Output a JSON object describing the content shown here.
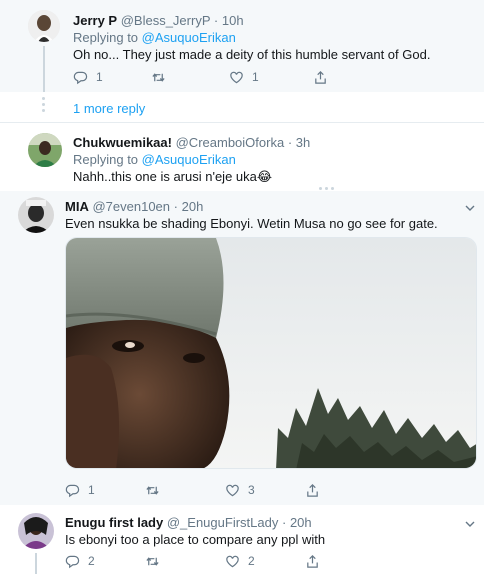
{
  "tweets": [
    {
      "name": "Jerry P",
      "handle": "@Bless_JerryP",
      "time": "10h",
      "replying_prefix": "Replying to",
      "replying_handle": "@AsuquoErikan",
      "text": "Oh no... They just made a deity of this humble servant of God.",
      "replies": "1",
      "retweets": "",
      "likes": "1"
    },
    {
      "name": "Chukwuemikaa!",
      "handle": "@CreamboiOforka",
      "time": "3h",
      "replying_prefix": "Replying to",
      "replying_handle": "@AsuquoErikan",
      "text": "Nahh..this one is arusi n'eje uka😂"
    },
    {
      "name": "MIA",
      "handle": "@7even10en",
      "time": "20h",
      "text": "Even nsukka be shading Ebonyi. Wetin Musa no go see for gate.",
      "replies": "1",
      "retweets": "",
      "likes": "3"
    },
    {
      "name": "Enugu first lady",
      "handle": "@_EnuguFirstLady",
      "time": "20h",
      "text": "Is ebonyi too a place to compare any ppl with",
      "replies": "2",
      "retweets": "",
      "likes": "2"
    }
  ],
  "thread": {
    "more_replies_label": "1 more reply"
  },
  "icons": [
    "reply-icon",
    "retweet-icon",
    "like-icon",
    "share-icon",
    "chevron-down-icon"
  ],
  "colors": {
    "link": "#1da1f2",
    "muted": "#657786",
    "text": "#14171a",
    "shaded_bg": "#f5f8fa",
    "thread_line": "#ccd6dd"
  }
}
